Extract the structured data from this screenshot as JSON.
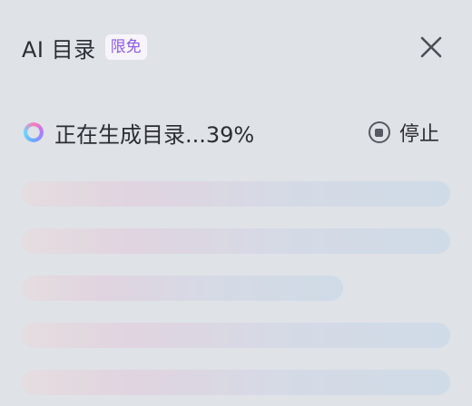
{
  "header": {
    "title": "AI 目录",
    "badge": "限免"
  },
  "status": {
    "text": "正在生成目录...39%",
    "progress_percent": 39,
    "stop_label": "停止"
  },
  "icons": {
    "close": "close-icon",
    "spinner": "loading-spinner-icon",
    "stop": "stop-circle-icon"
  },
  "colors": {
    "background": "#dfe2e7",
    "badge_text": "#8f5ae6",
    "badge_bg": "#f7f5fb"
  },
  "skeleton": {
    "line_count": 5
  }
}
